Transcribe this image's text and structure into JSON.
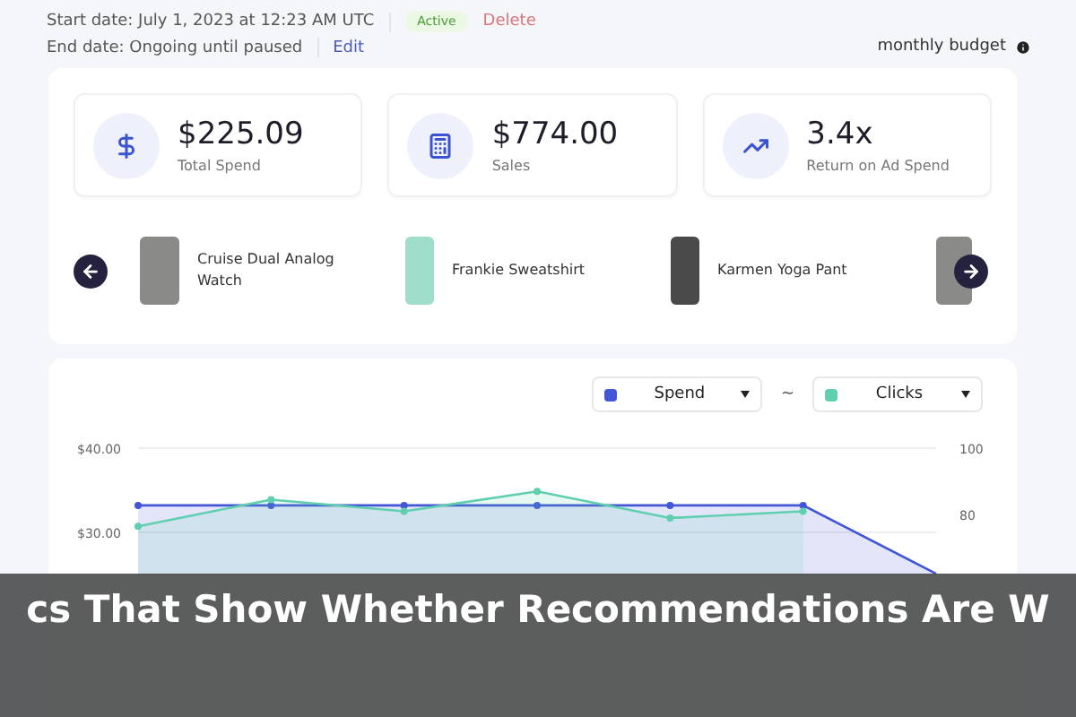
{
  "campaign": {
    "start_date": "Start date: July 1, 2023 at 12:23 AM UTC",
    "status": "Active",
    "delete": "Delete",
    "end_date": "End date: Ongoing until paused",
    "edit": "Edit",
    "budget_note": "monthly budget"
  },
  "stats": [
    {
      "kind": "dollar",
      "value": "$225.09",
      "label": "Total Spend"
    },
    {
      "kind": "calculator",
      "value": "$774.00",
      "label": "Sales"
    },
    {
      "kind": "trend",
      "value": "3.4x",
      "label": "Return on Ad Spend"
    }
  ],
  "products": [
    {
      "kind": "watch",
      "name": "Cruise Dual Analog Watch"
    },
    {
      "kind": "sweatshirt",
      "name": "Frankie Sweatshirt"
    },
    {
      "kind": "pants",
      "name": "Karmen Yoga Pant"
    },
    {
      "kind": "watch"
    }
  ],
  "chart": {
    "separator": "~",
    "chart_data": {
      "type": "area",
      "series": [
        {
          "name": "Spend",
          "color": "#4356d6",
          "marker": "circle",
          "values": [
            33.2,
            33.2,
            33.2,
            33.2,
            33.2,
            33.2,
            25.1
          ]
        },
        {
          "name": "Clicks",
          "color": "#5fcfb0",
          "marker": "circle",
          "axis": "y2",
          "values": [
            76.5,
            84.5,
            81,
            87,
            79,
            81,
            null
          ]
        }
      ],
      "ylim": [
        25,
        40
      ],
      "yticks": [
        {
          "value": 40,
          "label": "$40.00"
        },
        {
          "value": 30,
          "label": "$30.00"
        }
      ],
      "y2lim": [
        62,
        100
      ],
      "y2ticks": [
        100,
        80
      ]
    }
  },
  "caption": "cs That Show Whether Recommendations Are W"
}
